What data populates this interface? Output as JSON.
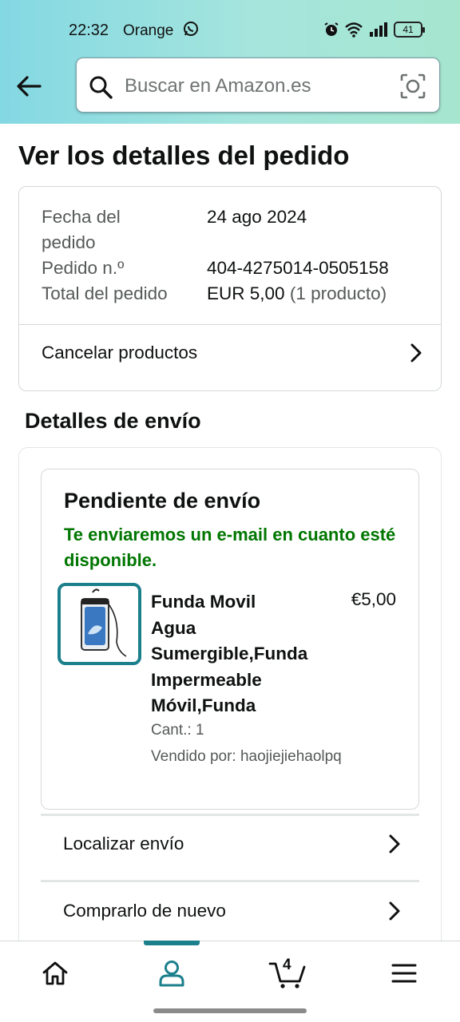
{
  "status_bar": {
    "time": "22:32",
    "carrier": "Orange",
    "battery": "41"
  },
  "search": {
    "placeholder": "Buscar en Amazon.es"
  },
  "page": {
    "title": "Ver los detalles del pedido"
  },
  "order_summary": {
    "date_label_line1": "Fecha del",
    "date_label_line2": "pedido",
    "date_value": "24 ago 2024",
    "order_number_label": "Pedido n.º",
    "order_number_value": "404-4275014-0505158",
    "total_label": "Total del pedido",
    "total_value": "EUR 5,00",
    "total_items": "(1 producto)",
    "cancel_label": "Cancelar productos"
  },
  "shipping": {
    "section_title": "Detalles de envío",
    "status": "Pendiente de envío",
    "message": "Te enviaremos un e-mail en cuanto esté disponible.",
    "product": {
      "title_lines": [
        "Funda Movil",
        "Agua",
        "Sumergible,Funda",
        "Impermeable",
        "Móvil,Funda"
      ],
      "price": "€5,00",
      "quantity": "Cant.: 1",
      "seller": "Vendido por: haojiejiehaolpq"
    },
    "track_label": "Localizar envío",
    "buy_again_label": "Comprarlo de nuevo"
  },
  "bottom_nav": {
    "cart_count": "4",
    "active_tab": "account"
  },
  "colors": {
    "accent": "#1b7f8c",
    "success": "#007600",
    "text": "#0f1111",
    "muted": "#565959"
  }
}
